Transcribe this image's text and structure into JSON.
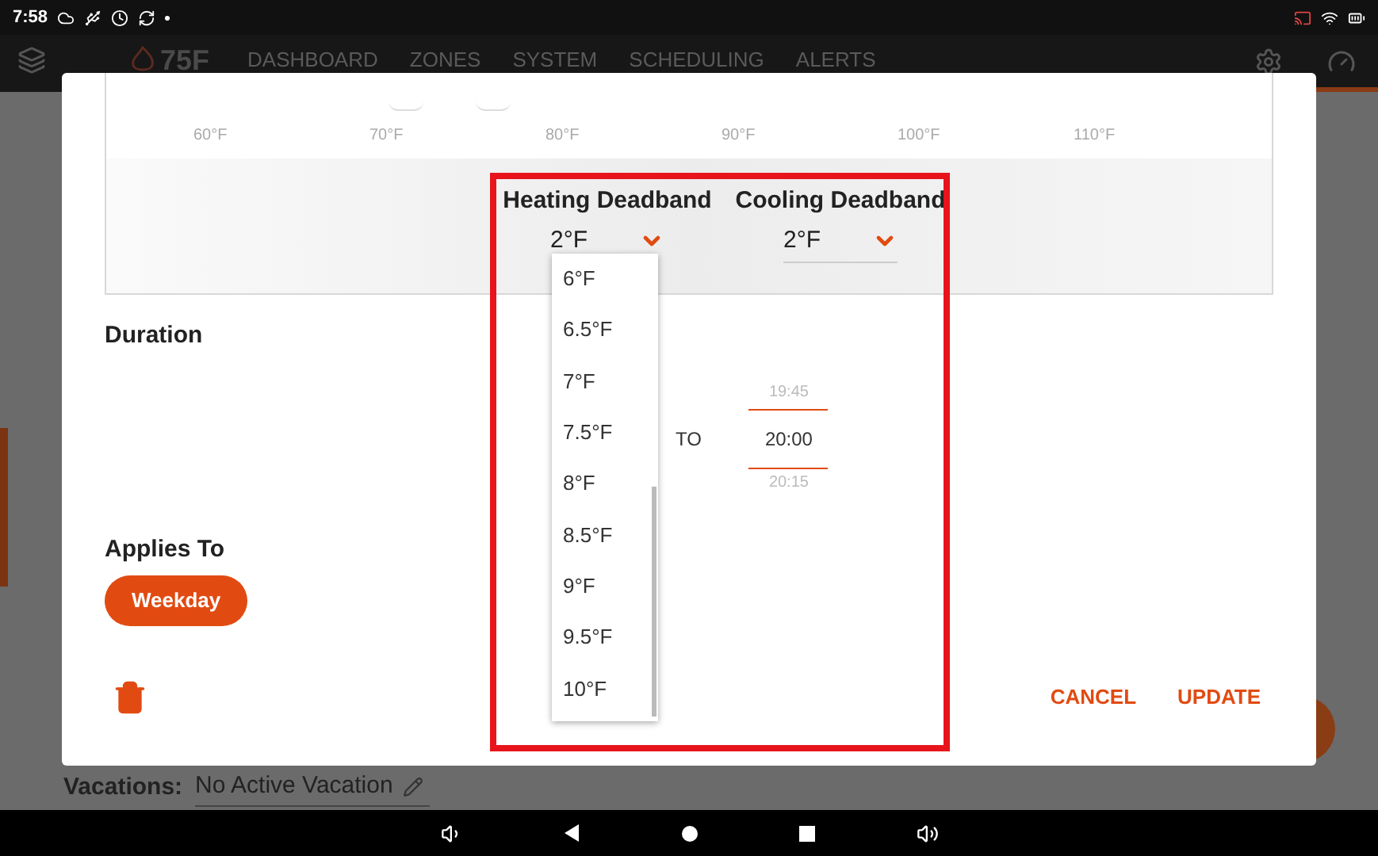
{
  "status_bar": {
    "time": "7:58"
  },
  "nav": {
    "logo": "75F",
    "items": [
      {
        "label": "DASHBOARD",
        "selected": false
      },
      {
        "label": "ZONES",
        "selected": false
      },
      {
        "label": "SYSTEM",
        "selected": false
      },
      {
        "label": "SCHEDULING",
        "selected": false
      },
      {
        "label": "ALERTS",
        "selected": false
      }
    ]
  },
  "dialog": {
    "scale_ticks": [
      "60°F",
      "70°F",
      "80°F",
      "90°F",
      "100°F",
      "110°F"
    ],
    "deadbands": [
      {
        "label": "Heating Deadband",
        "value": "2°F",
        "open": true
      },
      {
        "label": "Cooling Deadband",
        "value": "2°F",
        "open": false
      }
    ],
    "dropdown_options": [
      "6°F",
      "6.5°F",
      "7°F",
      "7.5°F",
      "8°F",
      "8.5°F",
      "9°F",
      "9.5°F",
      "10°F"
    ],
    "duration": {
      "label": "Duration",
      "to_label": "TO",
      "end_time": {
        "previous": "19:45",
        "value": "20:00",
        "next": "20:15"
      }
    },
    "applies_to": {
      "label": "Applies To",
      "days": [
        {
          "label": "Weekday",
          "selected": true
        }
      ]
    },
    "buttons": [
      "CANCEL",
      "UPDATE"
    ]
  },
  "background": {
    "vacations_label": "Vacations:",
    "vacations_value": "No Active Vacation"
  }
}
